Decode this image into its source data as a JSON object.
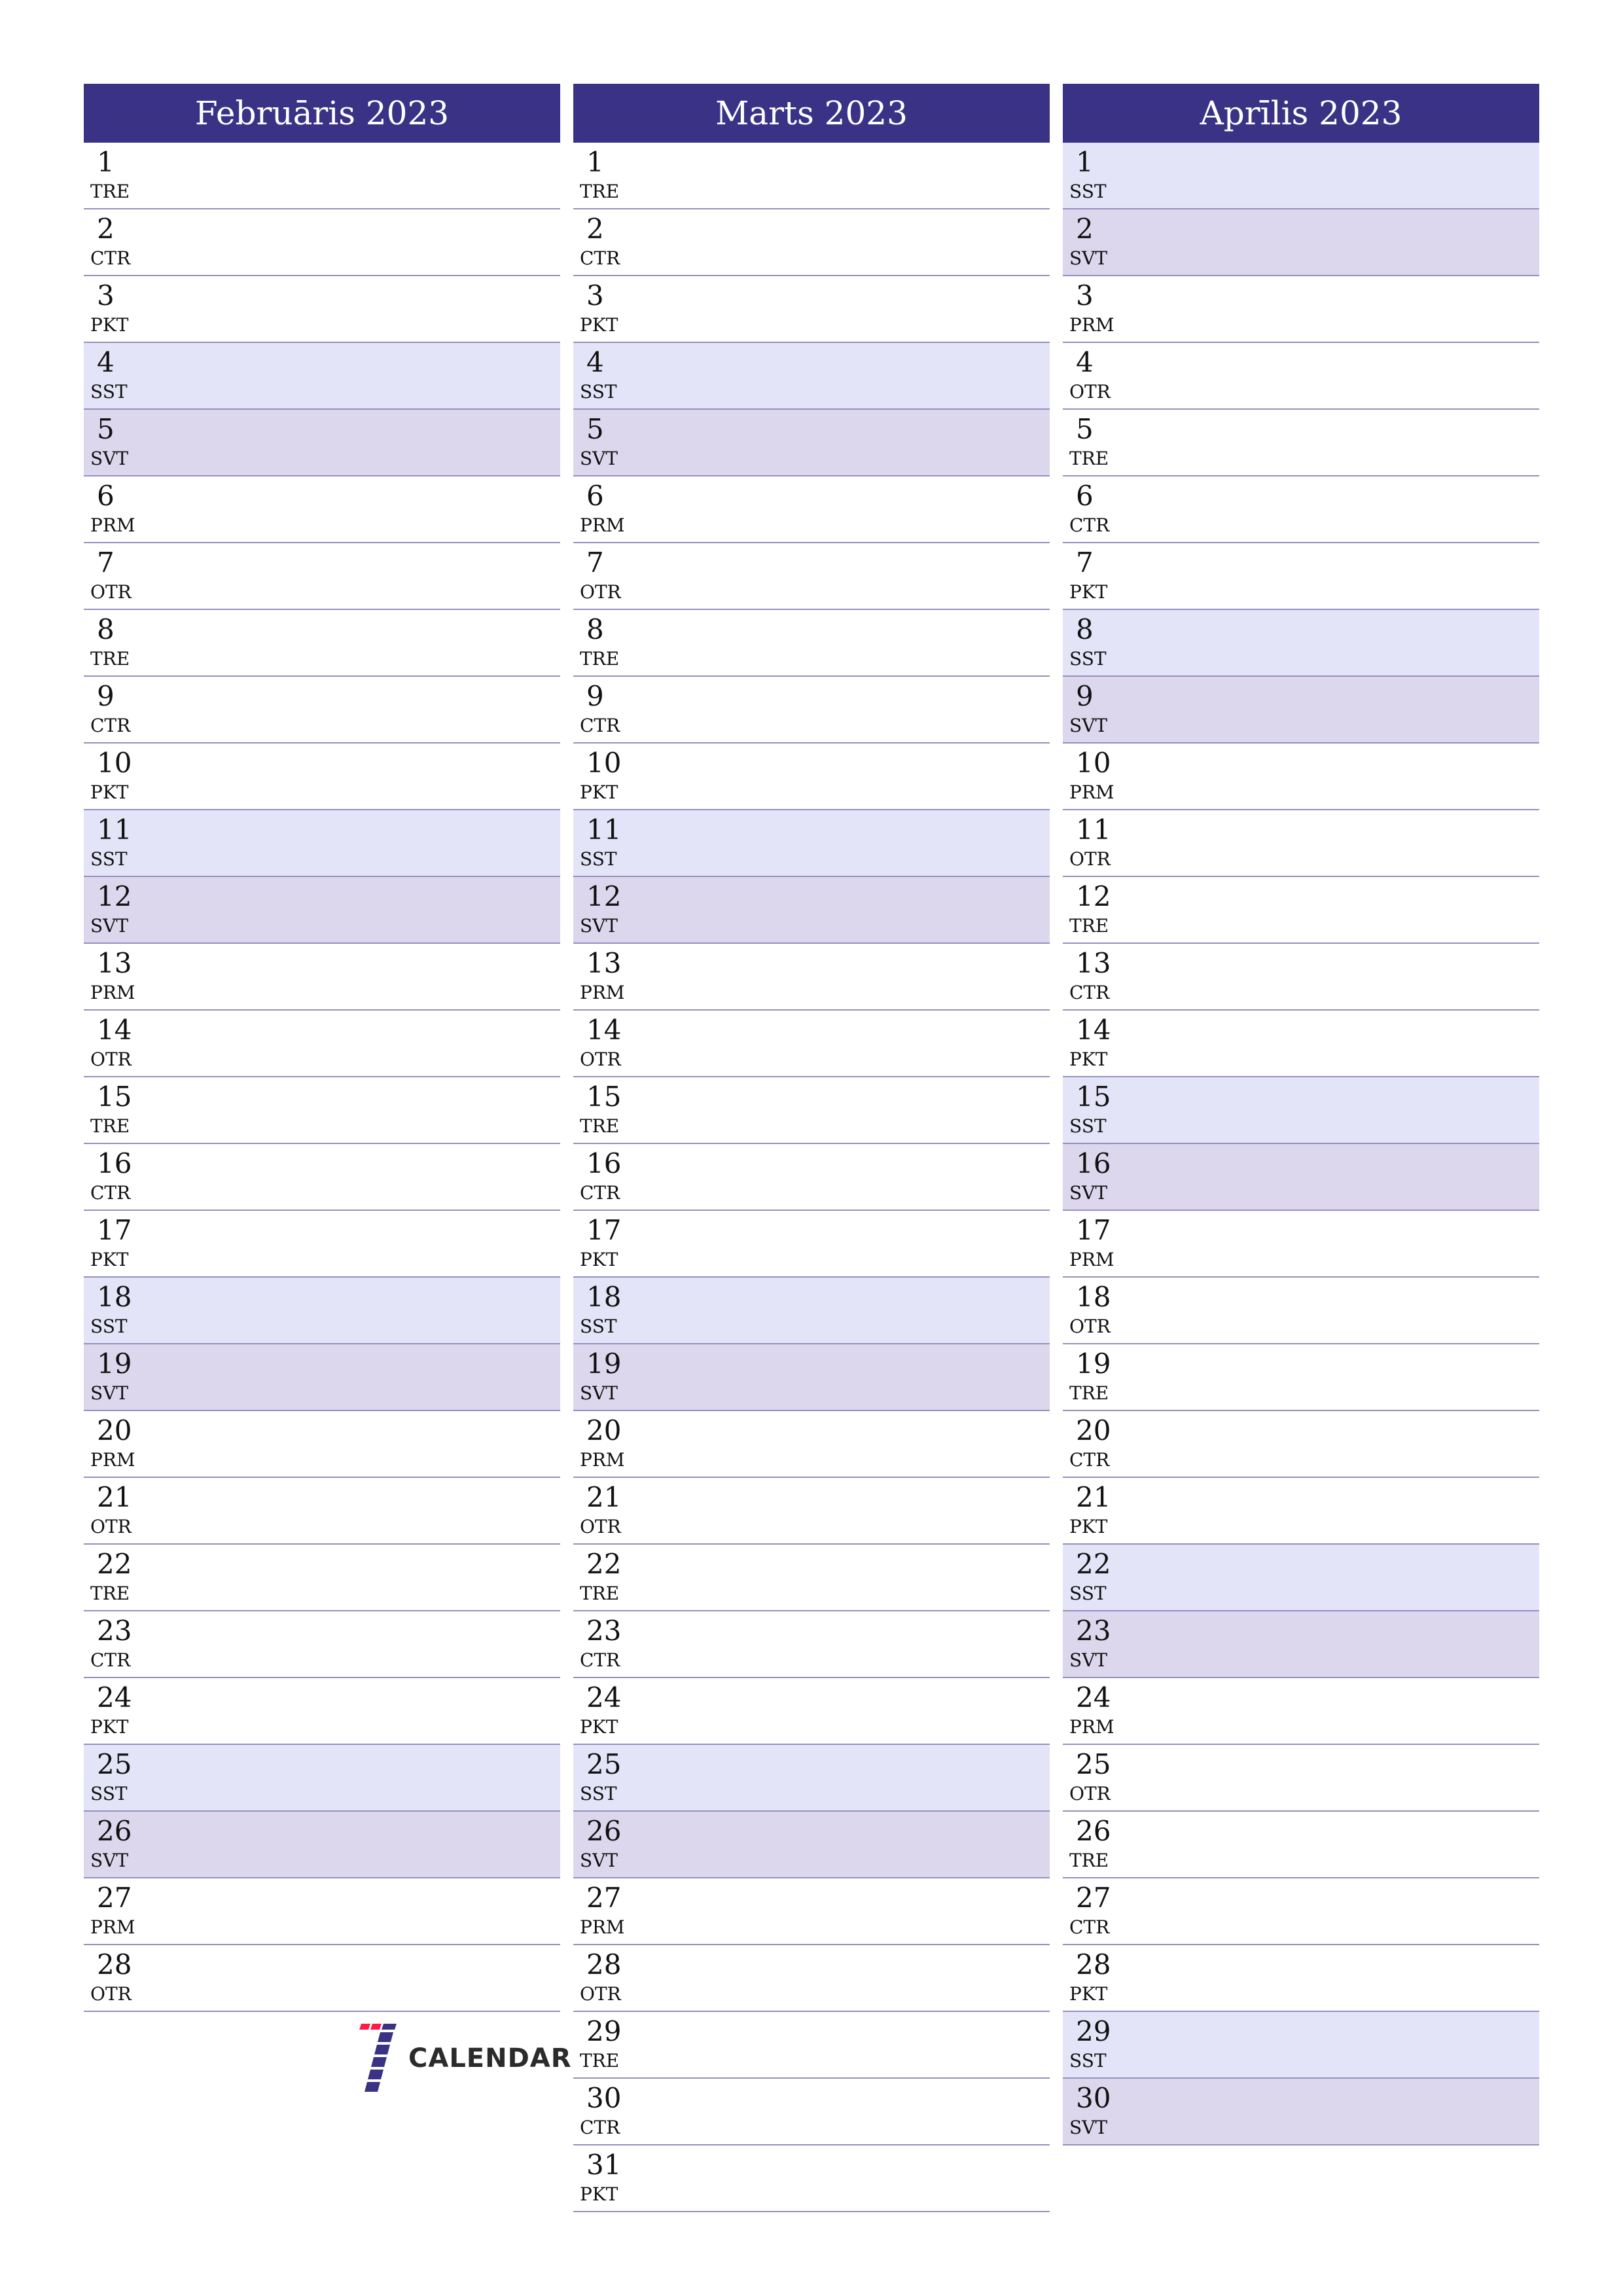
{
  "colors": {
    "header_bg": "#3a3385",
    "header_text": "#ffffff",
    "saturday_bg": "#e4e4f8",
    "sunday_bg": "#dcd7ed",
    "row_divider": "#9490bf",
    "logo_red": "#ff1a47",
    "logo_blue": "#3a3385",
    "logo_text": "#2b2b2b"
  },
  "months": [
    {
      "title": "Februāris 2023",
      "days": [
        {
          "num": "1",
          "name": "TRE"
        },
        {
          "num": "2",
          "name": "CTR"
        },
        {
          "num": "3",
          "name": "PKT"
        },
        {
          "num": "4",
          "name": "SST",
          "type": "sat"
        },
        {
          "num": "5",
          "name": "SVT",
          "type": "sun"
        },
        {
          "num": "6",
          "name": "PRM"
        },
        {
          "num": "7",
          "name": "OTR"
        },
        {
          "num": "8",
          "name": "TRE"
        },
        {
          "num": "9",
          "name": "CTR"
        },
        {
          "num": "10",
          "name": "PKT"
        },
        {
          "num": "11",
          "name": "SST",
          "type": "sat"
        },
        {
          "num": "12",
          "name": "SVT",
          "type": "sun"
        },
        {
          "num": "13",
          "name": "PRM"
        },
        {
          "num": "14",
          "name": "OTR"
        },
        {
          "num": "15",
          "name": "TRE"
        },
        {
          "num": "16",
          "name": "CTR"
        },
        {
          "num": "17",
          "name": "PKT"
        },
        {
          "num": "18",
          "name": "SST",
          "type": "sat"
        },
        {
          "num": "19",
          "name": "SVT",
          "type": "sun"
        },
        {
          "num": "20",
          "name": "PRM"
        },
        {
          "num": "21",
          "name": "OTR"
        },
        {
          "num": "22",
          "name": "TRE"
        },
        {
          "num": "23",
          "name": "CTR"
        },
        {
          "num": "24",
          "name": "PKT"
        },
        {
          "num": "25",
          "name": "SST",
          "type": "sat"
        },
        {
          "num": "26",
          "name": "SVT",
          "type": "sun"
        },
        {
          "num": "27",
          "name": "PRM"
        },
        {
          "num": "28",
          "name": "OTR"
        }
      ]
    },
    {
      "title": "Marts 2023",
      "days": [
        {
          "num": "1",
          "name": "TRE"
        },
        {
          "num": "2",
          "name": "CTR"
        },
        {
          "num": "3",
          "name": "PKT"
        },
        {
          "num": "4",
          "name": "SST",
          "type": "sat"
        },
        {
          "num": "5",
          "name": "SVT",
          "type": "sun"
        },
        {
          "num": "6",
          "name": "PRM"
        },
        {
          "num": "7",
          "name": "OTR"
        },
        {
          "num": "8",
          "name": "TRE"
        },
        {
          "num": "9",
          "name": "CTR"
        },
        {
          "num": "10",
          "name": "PKT"
        },
        {
          "num": "11",
          "name": "SST",
          "type": "sat"
        },
        {
          "num": "12",
          "name": "SVT",
          "type": "sun"
        },
        {
          "num": "13",
          "name": "PRM"
        },
        {
          "num": "14",
          "name": "OTR"
        },
        {
          "num": "15",
          "name": "TRE"
        },
        {
          "num": "16",
          "name": "CTR"
        },
        {
          "num": "17",
          "name": "PKT"
        },
        {
          "num": "18",
          "name": "SST",
          "type": "sat"
        },
        {
          "num": "19",
          "name": "SVT",
          "type": "sun"
        },
        {
          "num": "20",
          "name": "PRM"
        },
        {
          "num": "21",
          "name": "OTR"
        },
        {
          "num": "22",
          "name": "TRE"
        },
        {
          "num": "23",
          "name": "CTR"
        },
        {
          "num": "24",
          "name": "PKT"
        },
        {
          "num": "25",
          "name": "SST",
          "type": "sat"
        },
        {
          "num": "26",
          "name": "SVT",
          "type": "sun"
        },
        {
          "num": "27",
          "name": "PRM"
        },
        {
          "num": "28",
          "name": "OTR"
        },
        {
          "num": "29",
          "name": "TRE"
        },
        {
          "num": "30",
          "name": "CTR"
        },
        {
          "num": "31",
          "name": "PKT"
        }
      ]
    },
    {
      "title": "Aprīlis 2023",
      "days": [
        {
          "num": "1",
          "name": "SST",
          "type": "sat"
        },
        {
          "num": "2",
          "name": "SVT",
          "type": "sun"
        },
        {
          "num": "3",
          "name": "PRM"
        },
        {
          "num": "4",
          "name": "OTR"
        },
        {
          "num": "5",
          "name": "TRE"
        },
        {
          "num": "6",
          "name": "CTR"
        },
        {
          "num": "7",
          "name": "PKT"
        },
        {
          "num": "8",
          "name": "SST",
          "type": "sat"
        },
        {
          "num": "9",
          "name": "SVT",
          "type": "sun"
        },
        {
          "num": "10",
          "name": "PRM"
        },
        {
          "num": "11",
          "name": "OTR"
        },
        {
          "num": "12",
          "name": "TRE"
        },
        {
          "num": "13",
          "name": "CTR"
        },
        {
          "num": "14",
          "name": "PKT"
        },
        {
          "num": "15",
          "name": "SST",
          "type": "sat"
        },
        {
          "num": "16",
          "name": "SVT",
          "type": "sun"
        },
        {
          "num": "17",
          "name": "PRM"
        },
        {
          "num": "18",
          "name": "OTR"
        },
        {
          "num": "19",
          "name": "TRE"
        },
        {
          "num": "20",
          "name": "CTR"
        },
        {
          "num": "21",
          "name": "PKT"
        },
        {
          "num": "22",
          "name": "SST",
          "type": "sat"
        },
        {
          "num": "23",
          "name": "SVT",
          "type": "sun"
        },
        {
          "num": "24",
          "name": "PRM"
        },
        {
          "num": "25",
          "name": "OTR"
        },
        {
          "num": "26",
          "name": "TRE"
        },
        {
          "num": "27",
          "name": "CTR"
        },
        {
          "num": "28",
          "name": "PKT"
        },
        {
          "num": "29",
          "name": "SST",
          "type": "sat"
        },
        {
          "num": "30",
          "name": "SVT",
          "type": "sun"
        }
      ]
    }
  ],
  "logo": {
    "icon": "seven-calendar-logo-icon",
    "text": "CALENDAR"
  }
}
